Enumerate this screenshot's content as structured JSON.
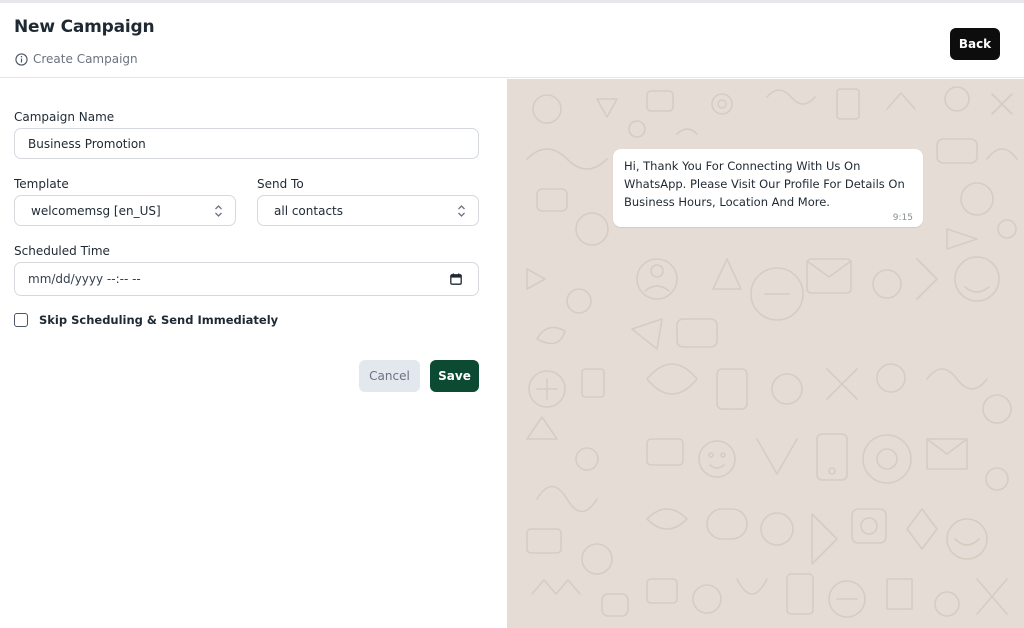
{
  "header": {
    "title": "New Campaign",
    "breadcrumb": "Create Campaign",
    "back_label": "Back"
  },
  "form": {
    "campaign_name": {
      "label": "Campaign Name",
      "value": "Business Promotion"
    },
    "template": {
      "label": "Template",
      "selected": "welcomemsg [en_US]"
    },
    "send_to": {
      "label": "Send To",
      "selected": "all contacts"
    },
    "scheduled_time": {
      "label": "Scheduled Time",
      "placeholder": "mm/dd/yyyy --:-- --"
    },
    "skip_scheduling": {
      "label": "Skip Scheduling & Send Immediately",
      "checked": false
    },
    "cancel_label": "Cancel",
    "save_label": "Save"
  },
  "preview": {
    "message": "Hi, Thank You For Connecting With Us On WhatsApp. Please Visit Our Profile For Details On Business Hours, Location And More.",
    "time": "9:15"
  },
  "colors": {
    "save_button": "#0c4a33",
    "back_button": "#0d0d0d",
    "cancel_button": "#e3e8ee",
    "chat_background": "#e5ddd5",
    "bubble": "#ffffff"
  },
  "icons": {
    "breadcrumb": "info-icon",
    "select": "chevron-up-down-icon",
    "date": "calendar-icon"
  }
}
